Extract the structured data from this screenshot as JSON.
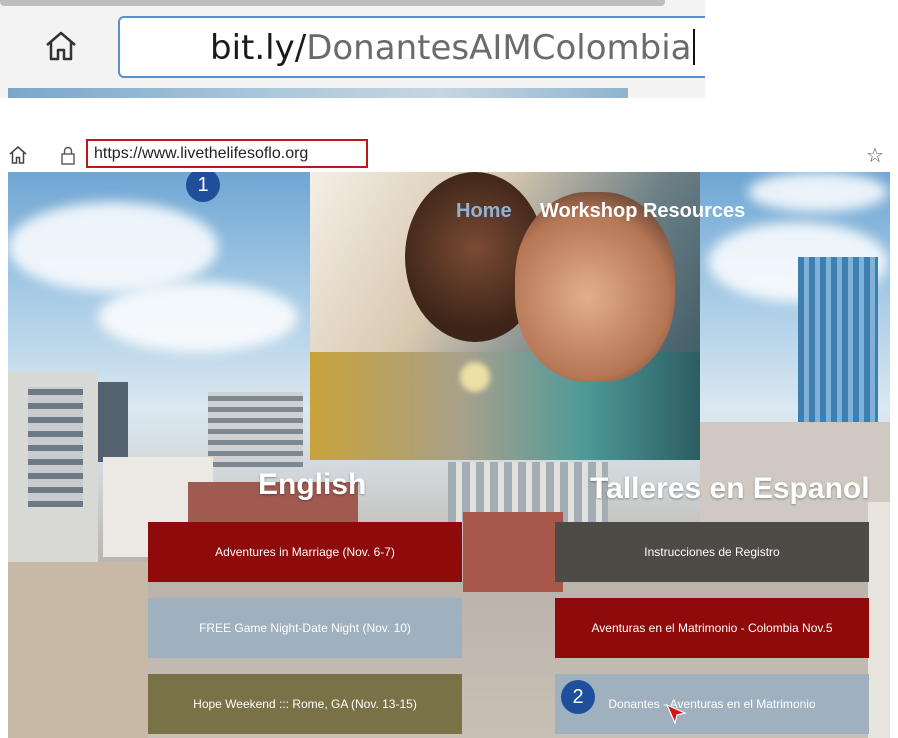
{
  "zoomed_address_bar": {
    "url_domain": "bit.ly/",
    "url_path": "DonantesAIMColombia"
  },
  "browser": {
    "url": "https://www.livethelifesoflo.org"
  },
  "site": {
    "nav": {
      "home_label": "Home",
      "workshop_label": "Workshop Resources"
    },
    "headings": {
      "english": "English",
      "spanish": "Talleres en Espanol"
    },
    "english_buttons": [
      "Adventures in Marriage (Nov. 6-7)",
      "FREE Game Night-Date Night (Nov. 10)",
      "Hope Weekend ::: Rome, GA (Nov. 13-15)"
    ],
    "spanish_buttons": [
      "Instrucciones de Registro",
      "Aventuras en el Matrimonio - Colombia Nov.5",
      "Donantes - Aventuras en el Matrimonio"
    ]
  },
  "annotations": {
    "step1": "1",
    "step2": "2"
  },
  "colors": {
    "tile_red": "#8f0a0a",
    "tile_blue": "#9fb0bf",
    "tile_olive": "#7a7247",
    "tile_gray": "#4d4b46",
    "badge": "#1f4f9a",
    "highlight": "#c0161b"
  }
}
